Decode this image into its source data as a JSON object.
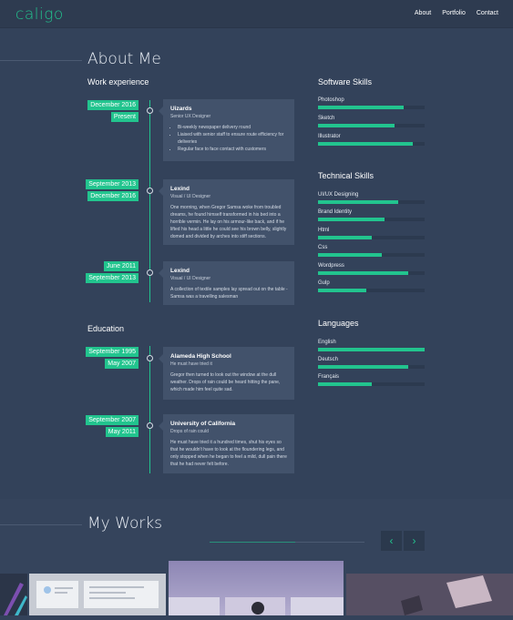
{
  "colors": {
    "accent": "#22c48e",
    "background": "#33425a",
    "card": "#42526b"
  },
  "brand": {
    "logo": "caligo"
  },
  "nav": {
    "items": [
      "About",
      "Portfolio",
      "Contact"
    ]
  },
  "about": {
    "title": "About Me"
  },
  "work": {
    "heading": "Work experience",
    "items": [
      {
        "dates": [
          "December 2016",
          "Present"
        ],
        "company": "Uizards",
        "role": "Senior UX Designer",
        "bullets": [
          "Bi-weekly newspaper delivery round",
          "Liaised with senior staff to ensure route efficiency for deliveries",
          "Regular face to face contact with customers"
        ]
      },
      {
        "dates": [
          "September 2013",
          "December 2016"
        ],
        "company": "Lexind",
        "role": "Visual / UI Designer",
        "text": "One morning, when Gregor Samsa woke from troubled dreams, he found himself transformed in his bed into a horrible vermin. He lay on his armour-like back, and if he lifted his head a little he could see his brown belly, slightly domed and divided by arches into stiff sections."
      },
      {
        "dates": [
          "June 2011",
          "September 2013"
        ],
        "company": "Lexind",
        "role": "Visual / UI Designer",
        "text": "A collection of textile samples lay spread out on the table - Samsa was a travelling salesman"
      }
    ]
  },
  "education": {
    "heading": "Education",
    "items": [
      {
        "dates": [
          "September 1995",
          "May 2007"
        ],
        "school": "Alameda High School",
        "subtitle": "He must have tried it",
        "text": "Gregor then turned to look out the window at the dull weather. Drops of rain could be heard hitting the pane, which made him feel quite sad."
      },
      {
        "dates": [
          "September 2007",
          "May 2011"
        ],
        "school": "University of California",
        "subtitle": "Drops of rain could",
        "text": "He must have tried it a hundred times, shut his eyes so that he wouldn't have to look at the floundering legs, and only stopped when he began to feel a mild, dull pain there that he had never felt before."
      }
    ]
  },
  "software": {
    "heading": "Software Skills",
    "items": [
      {
        "name": "Photoshop",
        "level": 0.8
      },
      {
        "name": "Sketch",
        "level": 0.72
      },
      {
        "name": "Illustrator",
        "level": 0.89
      }
    ]
  },
  "technical": {
    "heading": "Technical Skills",
    "items": [
      {
        "name": "UI/UX Designing",
        "level": 0.75
      },
      {
        "name": "Brand Identity",
        "level": 0.62
      },
      {
        "name": "Html",
        "level": 0.5
      },
      {
        "name": "Css",
        "level": 0.6
      },
      {
        "name": "Wordpress",
        "level": 0.85
      },
      {
        "name": "Gulp",
        "level": 0.45
      }
    ]
  },
  "languages": {
    "heading": "Languages",
    "items": [
      {
        "name": "English",
        "level": 1.0
      },
      {
        "name": "Deutsch",
        "level": 0.85
      },
      {
        "name": "Français",
        "level": 0.5
      }
    ]
  },
  "works": {
    "title": "My Works",
    "prev_icon": "chevron-left-icon",
    "next_icon": "chevron-right-icon",
    "prev": "‹",
    "next": "›"
  }
}
